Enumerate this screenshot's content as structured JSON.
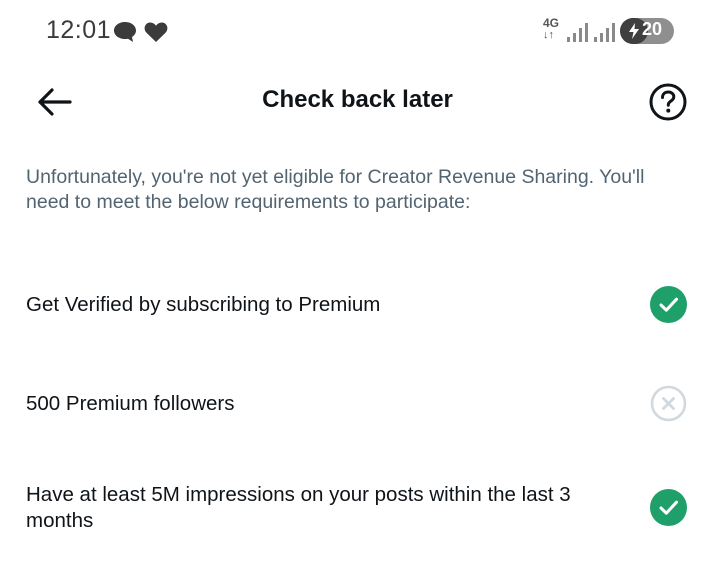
{
  "status_bar": {
    "time": "12:01",
    "network": "4G",
    "network_arrows": "↓↑",
    "battery": "20",
    "icons": [
      "chat-bubble-icon",
      "heart-icon",
      "signal-icon",
      "signal-icon",
      "charging-bolt-icon"
    ]
  },
  "header": {
    "title": "Check back later",
    "back_icon": "arrow-left-icon",
    "help_icon": "question-circle-icon"
  },
  "description": "Unfortunately, you're not yet eligible for Creator Revenue Sharing. You'll need to meet the below requirements to participate:",
  "requirements": [
    {
      "label": "Get Verified by subscribing to Premium",
      "met": true
    },
    {
      "label": "500 Premium followers",
      "met": false
    },
    {
      "label": "Have at least 5M impressions on your posts within the last 3 months",
      "met": true
    }
  ],
  "colors": {
    "met": "#1fa06a",
    "unmet": "#cfd9de",
    "text_primary": "#0f1419",
    "text_secondary": "#536471"
  }
}
